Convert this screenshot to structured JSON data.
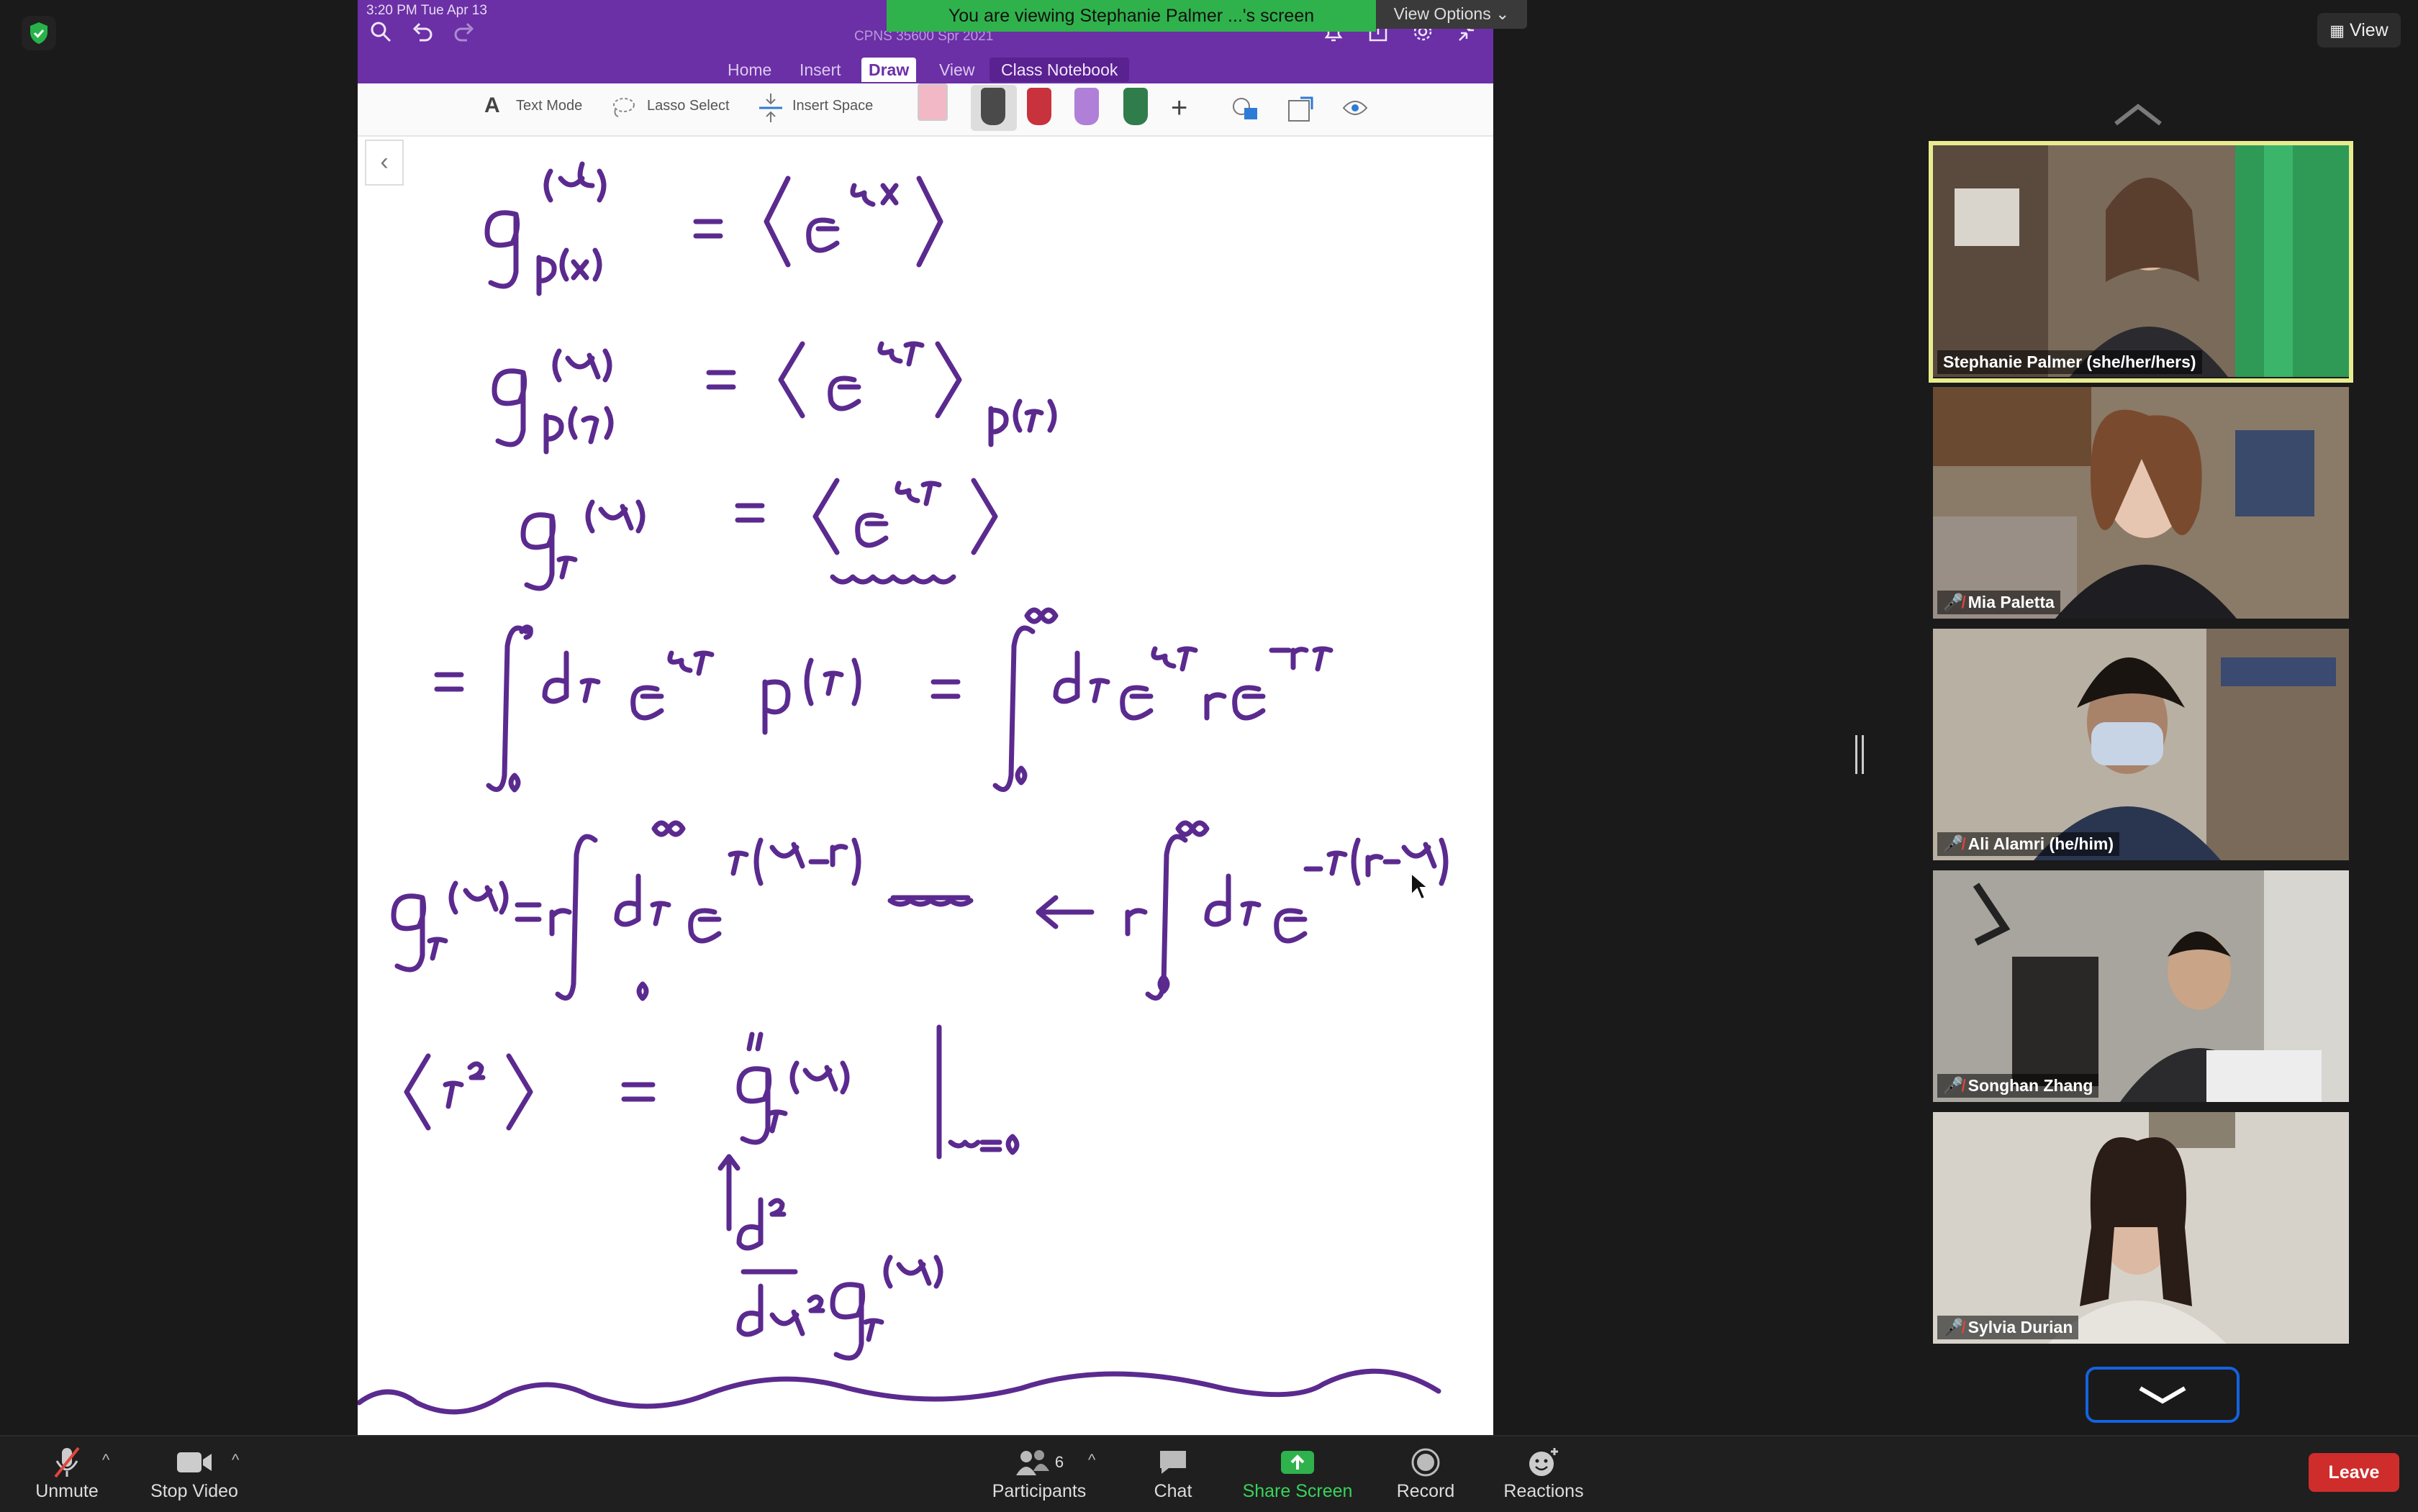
{
  "banner": {
    "text": "You are viewing Stephanie Palmer ...'s screen",
    "view_options": "View Options"
  },
  "view_button": "View",
  "onenote": {
    "status_time": "3:20 PM   Tue Apr 13",
    "notebook_title": "CPNS 35600 Spr 2021",
    "tabs": [
      "Home",
      "Insert",
      "Draw",
      "View",
      "Class Notebook"
    ],
    "toolbar": {
      "text_mode": "Text Mode",
      "lasso_select": "Lasso Select",
      "insert_space": "Insert Space"
    },
    "pen_colors": [
      "#e8a6b4",
      "#4a4a4a",
      "#c8323c",
      "#b07fd8",
      "#2f7d4a"
    ],
    "ink_color": "#5b2a8f"
  },
  "participants_panel": [
    {
      "name": "Stephanie Palmer (she/her/hers)",
      "muted": false,
      "active_speaker": true,
      "bg": "#5b4a3e"
    },
    {
      "name": "Mia Paletta",
      "muted": true,
      "active_speaker": false,
      "bg": "#6e5a48"
    },
    {
      "name": "Ali Alamri (he/him)",
      "muted": true,
      "active_speaker": false,
      "bg": "#8a8378"
    },
    {
      "name": "Songhan Zhang",
      "muted": true,
      "active_speaker": false,
      "bg": "#7a7670"
    },
    {
      "name": "Sylvia Durian",
      "muted": true,
      "active_speaker": false,
      "bg": "#cfcac2"
    }
  ],
  "toolbar": {
    "unmute": "Unmute",
    "stop_video": "Stop Video",
    "participants": "Participants",
    "participants_count": "6",
    "chat": "Chat",
    "share_screen": "Share Screen",
    "record": "Record",
    "reactions": "Reactions",
    "leave": "Leave"
  },
  "colors": {
    "accent_purple": "#6b2fa6",
    "share_green": "#2fb24c",
    "leave_red": "#cf2c2c",
    "speaker_highlight": "#e8ec8e"
  }
}
